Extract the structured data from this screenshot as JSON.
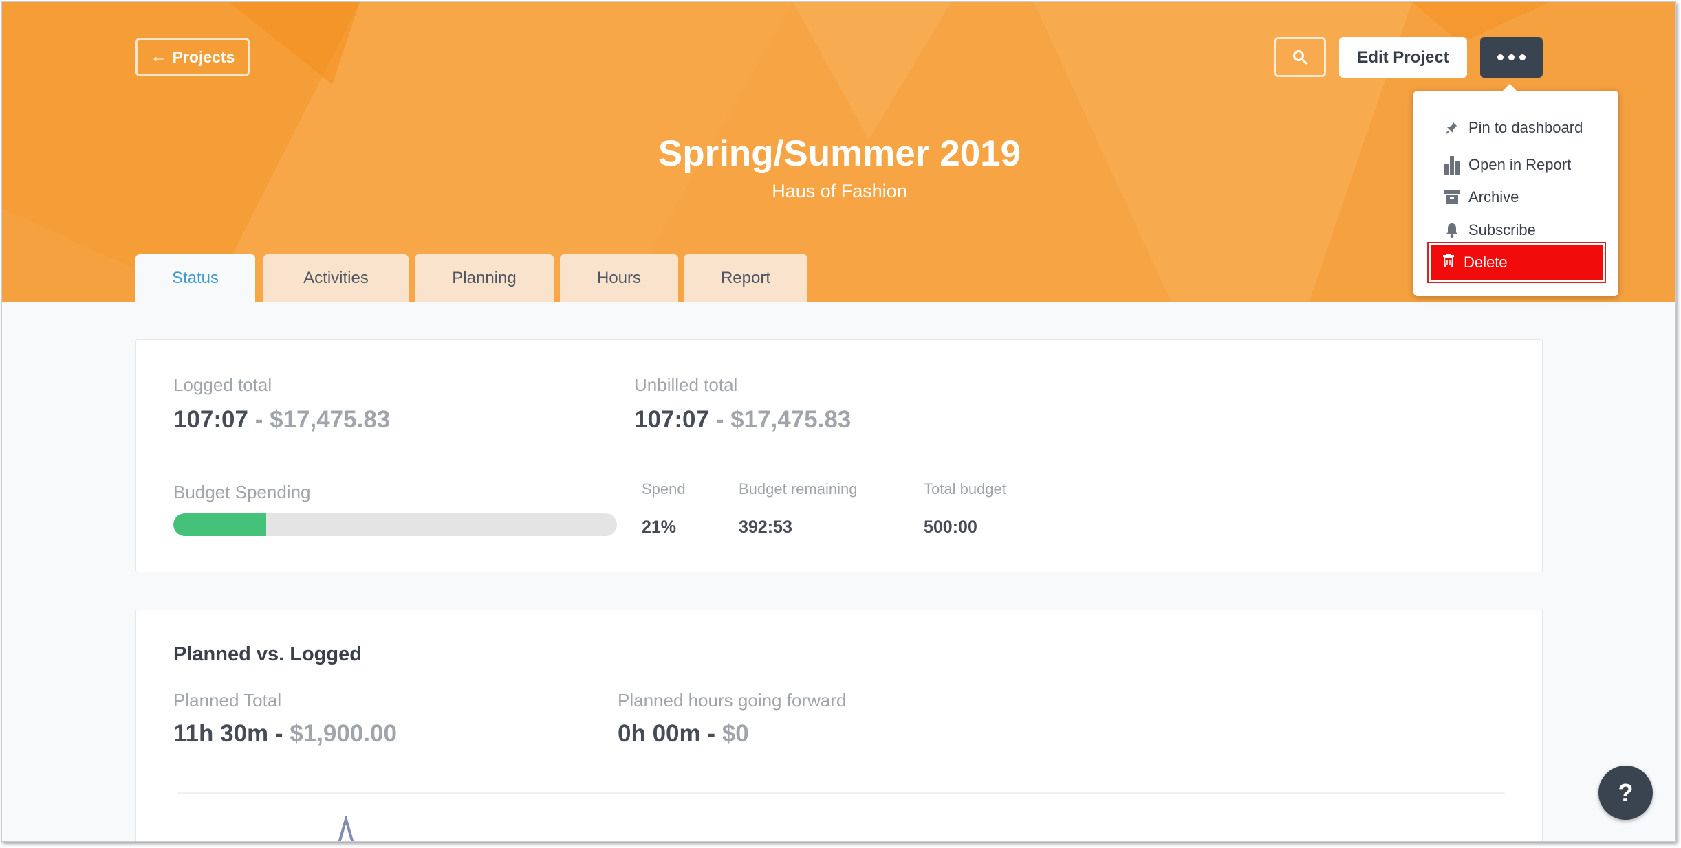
{
  "header": {
    "back_label": "Projects",
    "title": "Spring/Summer 2019",
    "subtitle": "Haus of Fashion",
    "edit_label": "Edit Project",
    "accent_color": "#f6a342"
  },
  "tabs": [
    {
      "label": "Status",
      "active": true
    },
    {
      "label": "Activities",
      "active": false
    },
    {
      "label": "Planning",
      "active": false
    },
    {
      "label": "Hours",
      "active": false
    },
    {
      "label": "Report",
      "active": false
    }
  ],
  "menu": {
    "items": [
      {
        "label": "Pin to dashboard",
        "icon": "pin-icon"
      },
      {
        "label": "Open in Report",
        "icon": "bar-chart-icon"
      },
      {
        "label": "Archive",
        "icon": "archive-icon"
      },
      {
        "label": "Subscribe",
        "icon": "bell-icon"
      }
    ],
    "delete_label": "Delete",
    "delete_color": "#f10b0b"
  },
  "status": {
    "logged_label": "Logged total",
    "logged_time": "107:07",
    "logged_money": "$17,475.83",
    "unbilled_label": "Unbilled total",
    "unbilled_time": "107:07",
    "unbilled_money": "$17,475.83",
    "budget_label": "Budget Spending",
    "budget_progress": 0.21,
    "spend_label": "Spend",
    "spend_value": "21%",
    "remaining_label": "Budget remaining",
    "remaining_value": "392:53",
    "total_label": "Total budget",
    "total_value": "500:00"
  },
  "planned": {
    "title": "Planned vs. Logged",
    "total_label": "Planned Total",
    "total_time": "11h 30m",
    "total_money": "$1,900.00",
    "forward_label": "Planned hours going forward",
    "forward_time": "0h 00m",
    "forward_money": "$0"
  },
  "separator": " - ",
  "help_label": "?"
}
